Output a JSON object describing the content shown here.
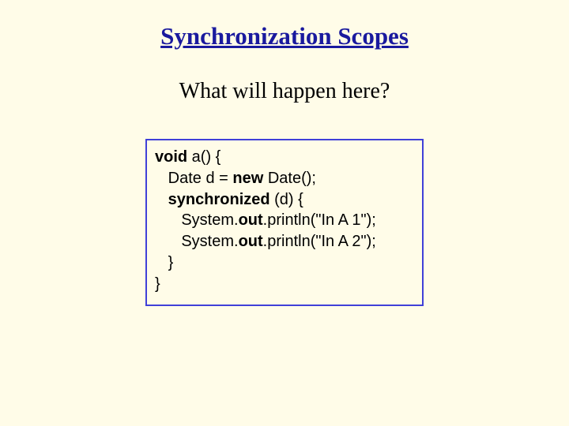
{
  "title": "Synchronization Scopes",
  "subtitle": "What will happen here?",
  "code": {
    "l1_kw": "void",
    "l1_rest": " a() {",
    "l2a": "   Date d = ",
    "l2_kw": "new",
    "l2b": " Date();",
    "l3a": "   ",
    "l3_kw": "synchronized",
    "l3b": " (d) {",
    "l4a": "      System.",
    "l4_kw": "out",
    "l4b": ".println(\"In A 1\");",
    "l5a": "      System.",
    "l5_kw": "out",
    "l5b": ".println(\"In A 2\");",
    "l6": "   }",
    "l7": "}"
  }
}
